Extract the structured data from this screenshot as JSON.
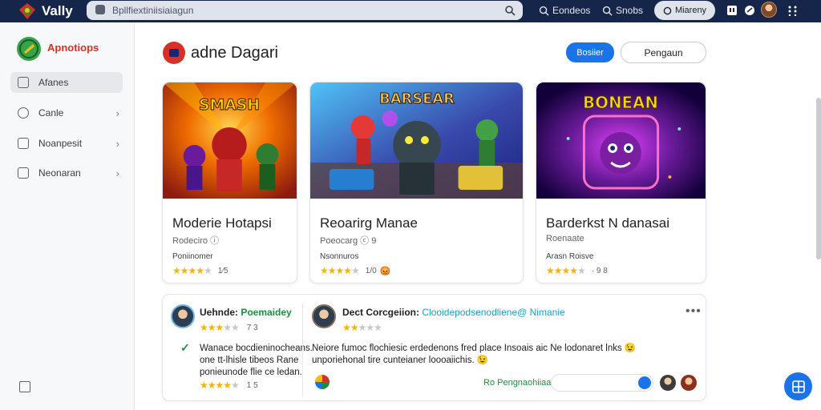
{
  "topbar": {
    "brand": "Vally",
    "search_text": "Bpllfiextiniisiaiagun",
    "nav": [
      "Eondeos",
      "Snobs"
    ],
    "pill_label": "Miareny"
  },
  "sidebar": {
    "title": "Apnotiops",
    "items": [
      {
        "label": "Afanes",
        "chevron": ""
      },
      {
        "label": "Canle",
        "chevron": "›"
      },
      {
        "label": "Noanpesit",
        "chevron": "›"
      },
      {
        "label": "Neonaran",
        "chevron": "›"
      }
    ]
  },
  "page": {
    "title": "adne Dagari",
    "primary_button": "Bosiier",
    "secondary_button": "Pengaun"
  },
  "cards": [
    {
      "title": "Moderie Hotapsi",
      "sub": "Rodeciro ⓘ",
      "meta": "Poniinomer",
      "rating": 4,
      "rating_text": "1⁄5",
      "banner": "SMASH",
      "emoji": ""
    },
    {
      "title": "Reoarirg Manae",
      "sub": "Poeocarg ⓒ 9",
      "meta": "Nsonnuros",
      "rating": 4,
      "rating_text": "1/0",
      "banner": "BARSEAR",
      "emoji": "😡"
    },
    {
      "title": "Barderkst N danasai",
      "sub": "Roenaate",
      "meta": "Arasn Roisve",
      "rating": 4,
      "rating_text": "· 9 8",
      "banner": "BONEAN",
      "emoji": ""
    }
  ],
  "reviews": {
    "left": {
      "name": "Uehnde:",
      "name_highlight": "Poemaidey",
      "rating": 3,
      "rating_text": "7 3",
      "text": [
        "Wanace bocdieninocheans.",
        "one tt-lhisle tibeos Rane",
        "ponieunode flie ce ledan."
      ],
      "footer_rating": 4,
      "footer_rating_text": "1 5"
    },
    "right": {
      "name": "Dect Corcgeiion:",
      "name_highlight": "Clooidepodsenodliene@ Nimanie",
      "rating": 2,
      "text": [
        "Neiore fumoc flochiesic erdedenons fred place Insoais aic Ne lodonaret lnks 😉",
        "unporiehonal tire cunteianer loooaiichis. 😉"
      ],
      "reply_label": "Ro Pengnaohiiaa"
    }
  },
  "colors": {
    "topbar": "#16254a",
    "accent": "#1a73e8",
    "sidebar_title": "#d93025",
    "star": "#f4b400"
  },
  "icons": [
    "search-icon",
    "compass-icon",
    "grid-icon",
    "notifications-icon",
    "chevron-right-icon",
    "more-icon",
    "send-icon",
    "dashboard-icon"
  ]
}
